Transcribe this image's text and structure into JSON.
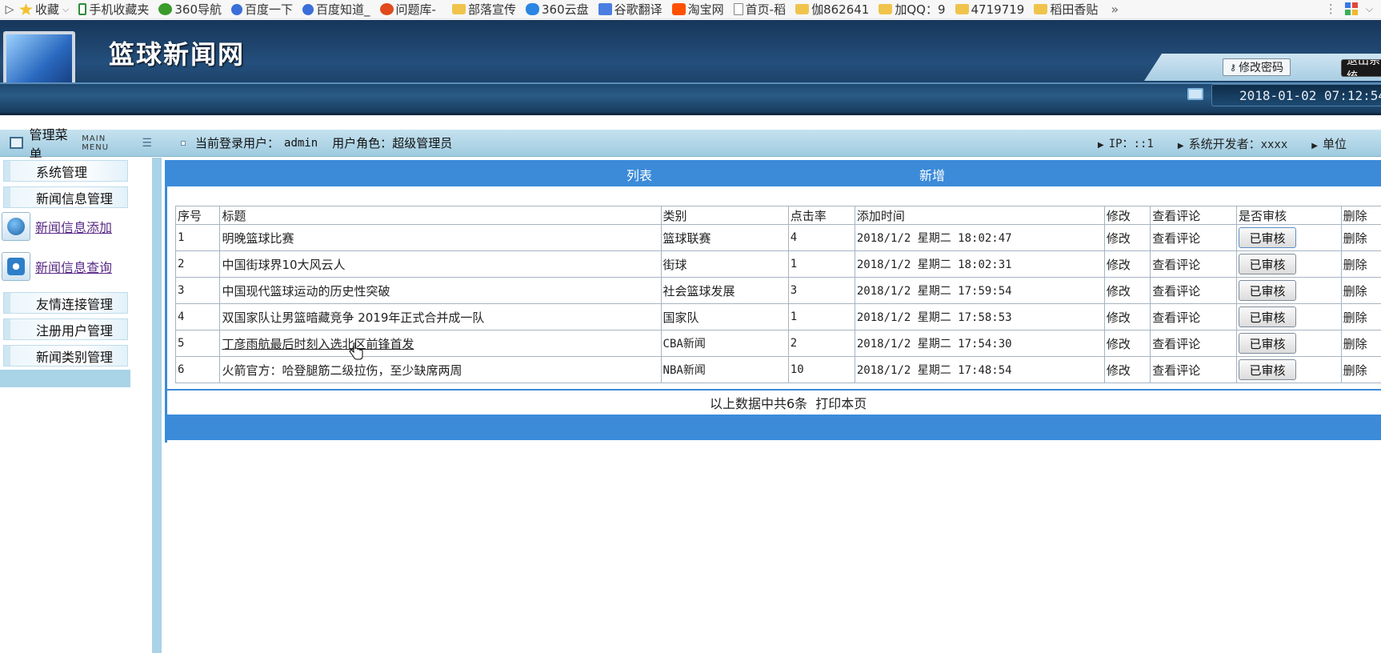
{
  "bookmarks": {
    "items": [
      {
        "label": "收藏",
        "icon": "star-icon"
      },
      {
        "label": "手机收藏夹",
        "icon": "phone-icon"
      },
      {
        "label": "360导航",
        "icon": "360-icon"
      },
      {
        "label": "百度一下",
        "icon": "paw-icon"
      },
      {
        "label": "百度知道_",
        "icon": "paw-icon"
      },
      {
        "label": "问题库-",
        "icon": "s-icon"
      },
      {
        "label": "部落宣传",
        "icon": "folder-icon"
      },
      {
        "label": "360云盘",
        "icon": "cloud-icon"
      },
      {
        "label": "谷歌翻译",
        "icon": "translate-icon"
      },
      {
        "label": "淘宝网",
        "icon": "taobao-icon"
      },
      {
        "label": "首页-稻",
        "icon": "page-icon"
      },
      {
        "label": "伽862641",
        "icon": "folder-icon"
      },
      {
        "label": "加QQ：9",
        "icon": "folder-icon"
      },
      {
        "label": "4719719",
        "icon": "folder-icon"
      },
      {
        "label": "稻田香贴",
        "icon": "folder-icon"
      }
    ],
    "more": "»"
  },
  "header": {
    "site_title": "篮球新闻网",
    "change_password": "修改密码",
    "logout": "退出系统",
    "datetime": "2018-01-02 07:12:54"
  },
  "info": {
    "menu_title": "管理菜单",
    "menu_subtitle": "MAIN MENU",
    "current_user_label": "当前登录用户：",
    "current_user": "admin",
    "role_label": "用户角色：",
    "role": "超级管理员",
    "ip_label": "IP：",
    "ip": "::1",
    "developer_label": "系统开发者：",
    "developer": "xxxx",
    "unit_label": "单位"
  },
  "sidebar": {
    "groups": [
      "系统管理",
      "新闻信息管理",
      "友情连接管理",
      "注册用户管理",
      "新闻类别管理"
    ],
    "sub_items": [
      "新闻信息添加",
      "新闻信息查询"
    ]
  },
  "main": {
    "tabs": [
      "列表",
      "新增"
    ],
    "columns": [
      "序号",
      "标题",
      "类别",
      "点击率",
      "添加时间",
      "修改",
      "查看评论",
      "是否审核",
      "删除"
    ],
    "rows": [
      {
        "id": "1",
        "title": "明晚篮球比赛",
        "category": "篮球联赛",
        "clicks": "4",
        "time": "2018/1/2 星期二 18:02:47",
        "edit": "修改",
        "comments": "查看评论",
        "audit": "已审核",
        "delete": "删除"
      },
      {
        "id": "2",
        "title": "中国街球界10大风云人",
        "category": "街球",
        "clicks": "1",
        "time": "2018/1/2 星期二 18:02:31",
        "edit": "修改",
        "comments": "查看评论",
        "audit": "已审核",
        "delete": "删除"
      },
      {
        "id": "3",
        "title": "中国现代篮球运动的历史性突破",
        "category": "社会篮球发展",
        "clicks": "3",
        "time": "2018/1/2 星期二 17:59:54",
        "edit": "修改",
        "comments": "查看评论",
        "audit": "已审核",
        "delete": "删除"
      },
      {
        "id": "4",
        "title": "双国家队让男篮暗藏竞争 2019年正式合并成一队",
        "category": "国家队",
        "clicks": "1",
        "time": "2018/1/2 星期二 17:58:53",
        "edit": "修改",
        "comments": "查看评论",
        "audit": "已审核",
        "delete": "删除"
      },
      {
        "id": "5",
        "title": "丁彦雨航最后时刻入选北区前锋首发",
        "category": "CBA新闻",
        "clicks": "2",
        "time": "2018/1/2 星期二 17:54:30",
        "edit": "修改",
        "comments": "查看评论",
        "audit": "已审核",
        "delete": "删除"
      },
      {
        "id": "6",
        "title": "火箭官方：哈登腿筋二级拉伤，至少缺席两周",
        "category": "NBA新闻",
        "clicks": "10",
        "time": "2018/1/2 星期二 17:48:54",
        "edit": "修改",
        "comments": "查看评论",
        "audit": "已审核",
        "delete": "删除"
      }
    ],
    "summary": "以上数据中共6条",
    "print": "打印本页"
  },
  "colors": {
    "accent": "#3b8bd9",
    "header_dark": "#17365a",
    "info_strip": "#b7dbe9",
    "link_visited": "#5a2a84"
  }
}
